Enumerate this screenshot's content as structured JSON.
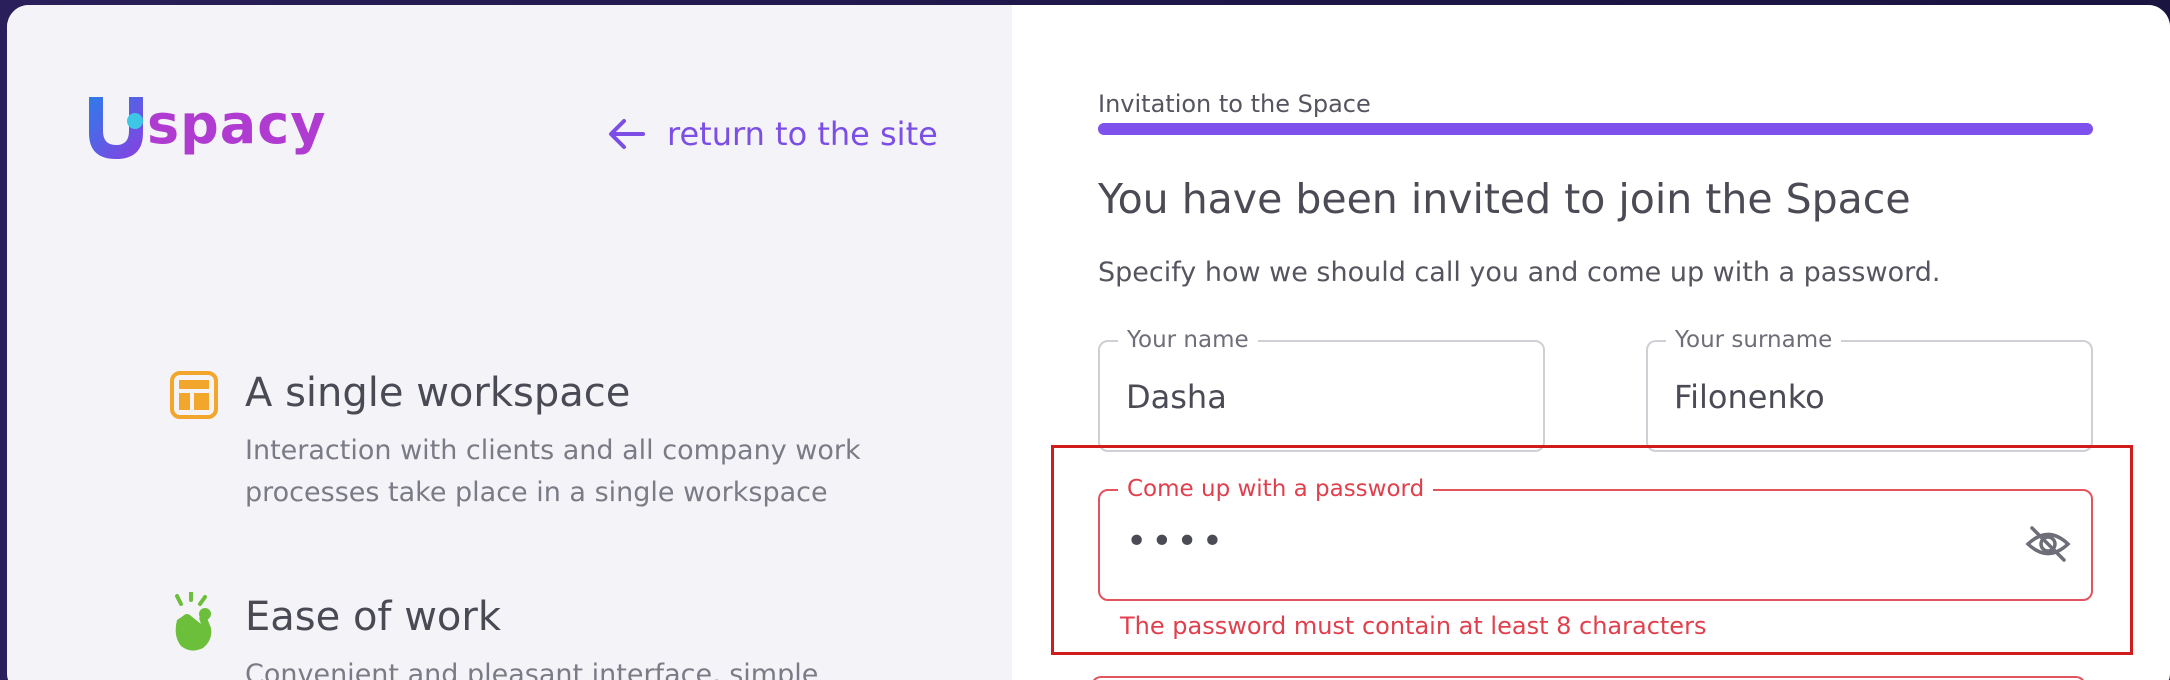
{
  "brand": {
    "logo_text": "spacy",
    "accent": "#7e50ec"
  },
  "nav": {
    "return_label": "return to the site"
  },
  "features": [
    {
      "title": "A single workspace",
      "description": "Interaction with clients and all company work processes take place in a single workspace",
      "icon": "layout-icon"
    },
    {
      "title": "Ease of work",
      "description": "Convenient and pleasant interface, simple",
      "icon": "snap-hand-icon"
    }
  ],
  "form": {
    "step_label": "Invitation to the Space",
    "heading": "You have been invited to join the Space",
    "subheading": "Specify how we should call you and come up with a password.",
    "name": {
      "label": "Your name",
      "value": "Dasha"
    },
    "surname": {
      "label": "Your surname",
      "value": "Filonenko"
    },
    "password": {
      "label": "Come up with a password",
      "value": "••••",
      "error": "The password must contain at least 8 characters"
    }
  }
}
